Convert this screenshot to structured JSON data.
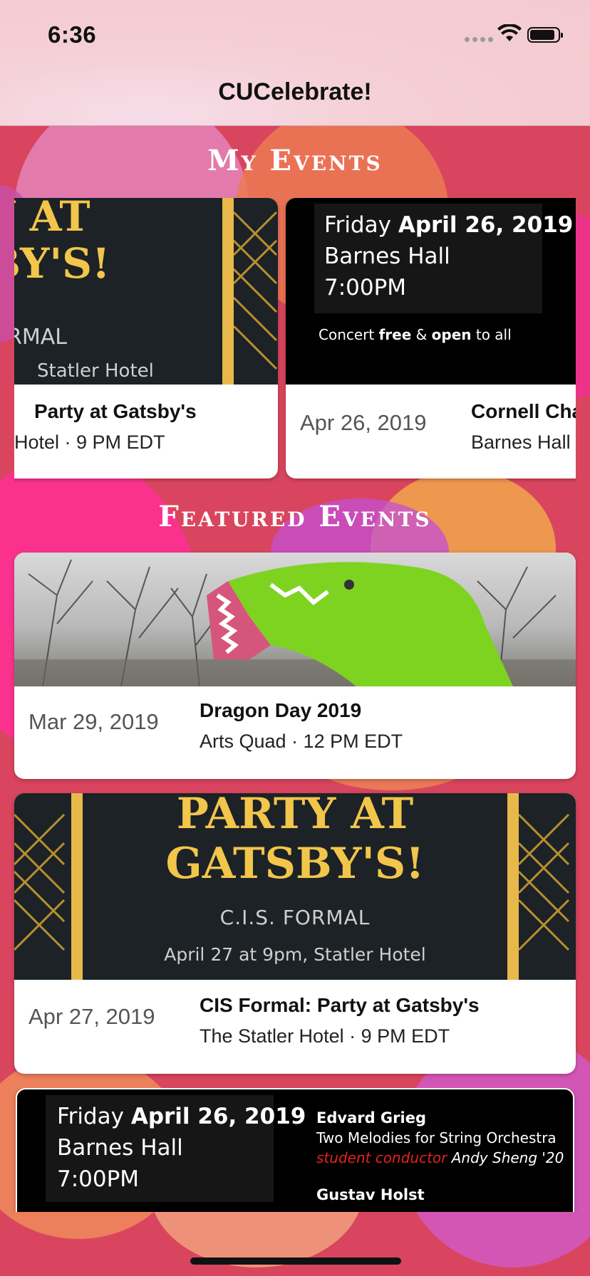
{
  "status_bar": {
    "time": "6:36"
  },
  "nav": {
    "title": "CUCelebrate!"
  },
  "my_events": {
    "heading": "My Events",
    "cards": [
      {
        "poster": {
          "line1": "Y AT",
          "line2": "BY'S!",
          "line3": "RMAL",
          "line4": "Statler Hotel"
        },
        "title": "Party at Gatsby's",
        "subtitle": "Hotel · 9 PM EDT"
      },
      {
        "poster": {
          "day": "Friday",
          "date": "April 26, 2019",
          "venue": "Barnes Hall",
          "time": "7:00PM",
          "note_pre": "Concert",
          "note_free": "free",
          "note_amp": "&",
          "note_open": "open",
          "note_post": "to all"
        },
        "date": "Apr 26, 2019",
        "title": "Cornell Cha",
        "subtitle": "Barnes Hall"
      }
    ]
  },
  "featured_events": {
    "heading": "Featured Events",
    "cards": [
      {
        "date": "Mar 29, 2019",
        "title": "Dragon Day 2019",
        "subtitle": "Arts Quad · 12 PM EDT"
      },
      {
        "poster": {
          "line1": "PARTY AT",
          "line2": "GATSBY'S!",
          "line3": "C.I.S. FORMAL",
          "line4": "April 27 at 9pm, Statler Hotel"
        },
        "date": "Apr 27, 2019",
        "title": "CIS Formal: Party at Gatsby's",
        "subtitle": "The Statler Hotel · 9 PM EDT"
      },
      {
        "poster": {
          "day": "Friday",
          "date": "April 26, 2019",
          "venue": "Barnes Hall",
          "time": "7:00PM",
          "composer1": "Edvard Grieg",
          "piece1": "Two Melodies for String Orchestra",
          "role": "student conductor",
          "conductor": "Andy Sheng '20",
          "composer2": "Gustav Holst"
        }
      }
    ]
  },
  "colors": {
    "background": "#d9455e",
    "accent_gold": "#f2c54b",
    "conductor_red": "#e0241f"
  }
}
